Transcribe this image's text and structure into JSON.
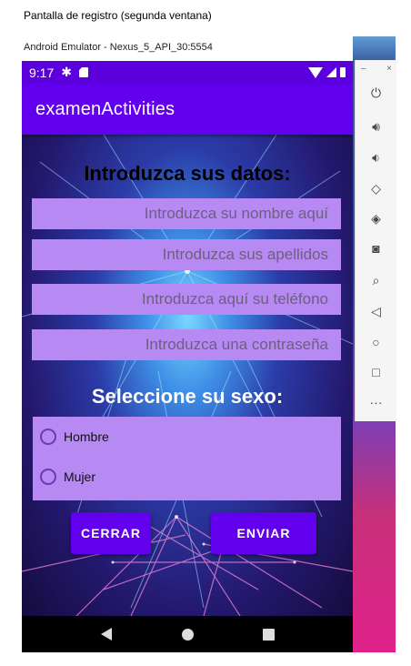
{
  "document_caption": "Pantalla de registro (segunda ventana)",
  "emulator": {
    "title": "Android Emulator - Nexus_5_API_30:5554"
  },
  "statusbar": {
    "time": "9:17"
  },
  "appbar": {
    "title": "examenActivities"
  },
  "form": {
    "heading": "Introduzca sus datos:",
    "nombre_placeholder": "Introduzca su nombre aquí",
    "apellidos_placeholder": "Introduzca sus apellidos",
    "telefono_placeholder": "Introduzca aquí su teléfono",
    "password_placeholder": "Introduzca una contraseña"
  },
  "sexo": {
    "heading": "Seleccione su sexo:",
    "options": [
      {
        "label": "Hombre",
        "selected": false
      },
      {
        "label": "Mujer",
        "selected": false
      }
    ]
  },
  "buttons": {
    "cerrar": "CERRAR",
    "enviar": "ENVIAR"
  },
  "colors": {
    "primary": "#6200ee",
    "primary_dark": "#5b00dd",
    "field_bg": "#b689f3"
  },
  "emulator_toolbar": {
    "icons": [
      "power-icon",
      "volume-up-icon",
      "volume-down-icon",
      "rotate-left-icon",
      "rotate-right-icon",
      "camera-icon",
      "zoom-icon",
      "back-icon",
      "home-icon",
      "overview-icon",
      "more-icon"
    ]
  }
}
